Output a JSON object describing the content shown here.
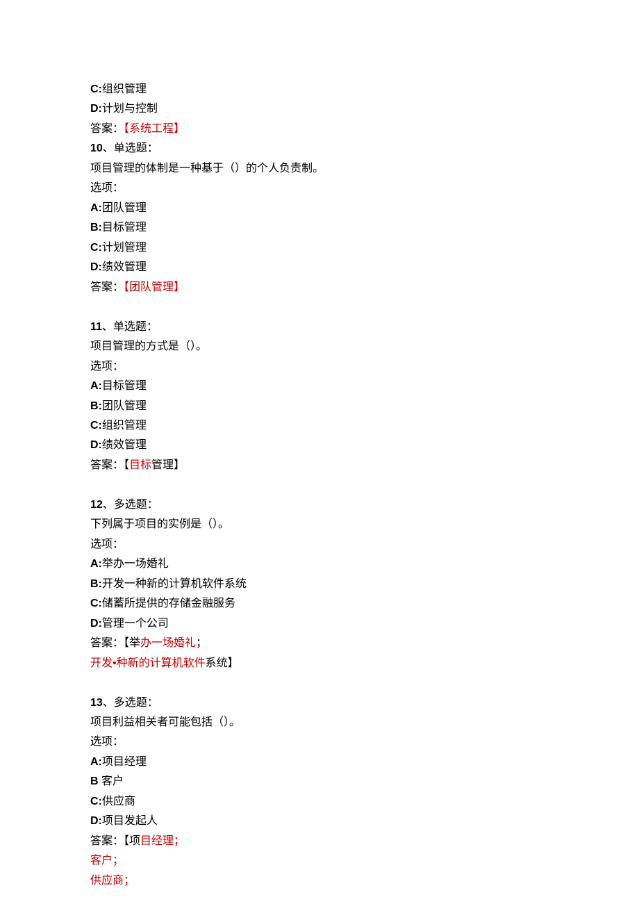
{
  "q9_tail": {
    "opt_c_prefix": "C:",
    "opt_c_text": "组织管理",
    "opt_d_prefix": "D:",
    "opt_d_text": "计划与控制",
    "answer_label": "答案：",
    "answer_body": "【系统工程】"
  },
  "q10": {
    "num": "10",
    "num_suffix": "、单选题：",
    "question": "项目管理的体制是一种基于（）的个人负责制。",
    "options_label": "选项：",
    "opt_a_prefix": "A:",
    "opt_a_text": "团队管理",
    "opt_b_prefix": "B:",
    "opt_b_text": "目标管理",
    "opt_c_prefix": "C:",
    "opt_c_text": "计划管理",
    "opt_d_prefix": "D:",
    "opt_d_text": "绩效管理",
    "answer_label": "答案：",
    "answer_body": "【团队管理】"
  },
  "q11": {
    "num": "11",
    "num_suffix": "、单选题：",
    "question": "项目管理的方式是（）。",
    "options_label": "选项：",
    "opt_a_prefix": "A:",
    "opt_a_text": "目标管理",
    "opt_b_prefix": "B:",
    "opt_b_text": "团队管理",
    "opt_c_prefix": "C:",
    "opt_c_text": "组织管理",
    "opt_d_prefix": "D:",
    "opt_d_text": "绩效管理",
    "answer_label": "答案：",
    "answer_pre": "【",
    "answer_red": "目标",
    "answer_post": "管理】"
  },
  "q12": {
    "num": "12",
    "num_suffix": "、多选题：",
    "question": "下列属于项目的实例是（）。",
    "options_label": "选项：",
    "opt_a_prefix": "A:",
    "opt_a_text": "举办一场婚礼",
    "opt_b_prefix": "B:",
    "opt_b_text": "开发一种新的计算机软件系统",
    "opt_c_prefix": "C:",
    "opt_c_text": "储蓄所提供的存储金融服务",
    "opt_d_prefix": "D:",
    "opt_d_text": "管理一个公司",
    "answer_label": "答案：",
    "answer_l1_black1": "【举",
    "answer_l1_red": "办一场婚礼",
    "answer_l1_black2": "；",
    "answer_l2_red": "开发•种新的计算机软件",
    "answer_l2_black": "系统】"
  },
  "q13": {
    "num": "13",
    "num_suffix": "、多选题：",
    "question": "项目利益相关者可能包括（）。",
    "options_label": "选项：",
    "opt_a_prefix": "A:",
    "opt_a_text": "项目经理",
    "opt_b_black": "B ",
    "opt_b_text": "客户",
    "opt_c_prefix": "C:",
    "opt_c_text": "供应商",
    "opt_d_prefix": "D:",
    "opt_d_text": "项目发起人",
    "answer_label": "答案：",
    "answer_l1_black": "【项",
    "answer_l1_red": "目经理；",
    "answer_l2_red": "客户；",
    "answer_l3_red": "供应商；"
  }
}
